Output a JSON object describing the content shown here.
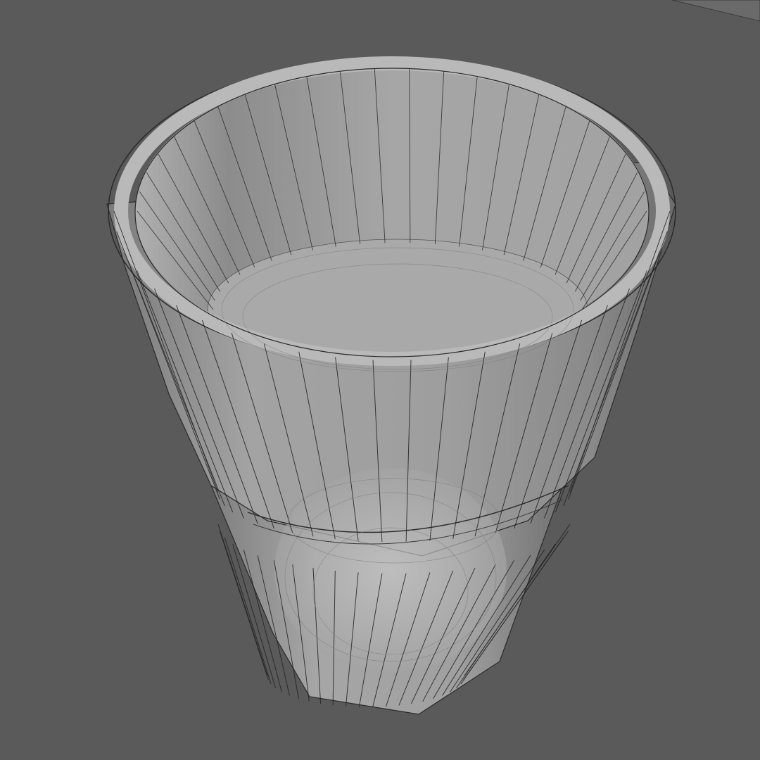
{
  "viewport": {
    "background_color": "#5a5a5a",
    "shading": "solid",
    "overlay": "wireframe"
  },
  "mesh": {
    "object": "glass-cup",
    "body_color": "#9b9b9b",
    "body_shadow_color": "#6e6e6e",
    "inner_color": "#a8a8a8",
    "rim_color": "#b4b4b4",
    "liquid_highlight_color": "#c8c8c8",
    "edge_color": "#1e1e1e",
    "faint_edge_color": "#6a6a6a"
  }
}
